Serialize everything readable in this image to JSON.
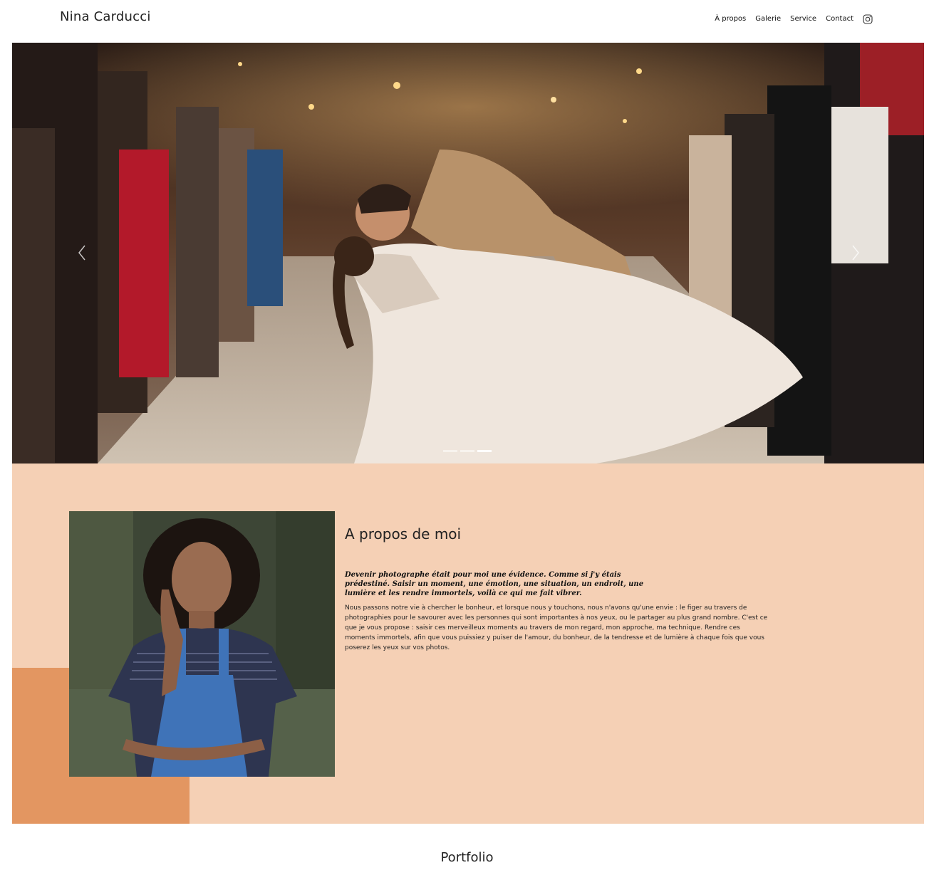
{
  "header": {
    "brand": "Nina Carducci",
    "nav": [
      "À propos",
      "Galerie",
      "Service",
      "Contact"
    ],
    "instagram_icon": "instagram-icon"
  },
  "hero": {
    "slide_count": 3,
    "active_slide": 3,
    "prev_icon": "chevron-left-icon",
    "next_icon": "chevron-right-icon"
  },
  "about": {
    "title": "A propos de moi",
    "quote": "Devenir photographe était pour moi une évidence. Comme si j'y étais prédestiné. Saisir un moment, une émotion, une situation, un endroit, une lumière et les rendre immortels, voilà ce qui me fait vibrer.",
    "body": "Nous passons notre vie à chercher le bonheur, et lorsque nous y touchons, nous n'avons qu'une envie : le figer au travers de photographies pour le savourer avec les personnes qui sont importantes à nos yeux, ou le partager au plus grand nombre. C'est ce que je vous propose : saisir ces merveilleux moments au travers de mon regard, mon approche, ma technique. Rendre ces moments immortels, afin que vous puissiez y puiser de l'amour, du bonheur, de la tendresse et de lumière à chaque fois que vous poserez les yeux sur vos photos."
  },
  "portfolio": {
    "title": "Portfolio"
  },
  "colors": {
    "about_bg": "#f5d0b5",
    "accent_orange": "#e39661"
  }
}
